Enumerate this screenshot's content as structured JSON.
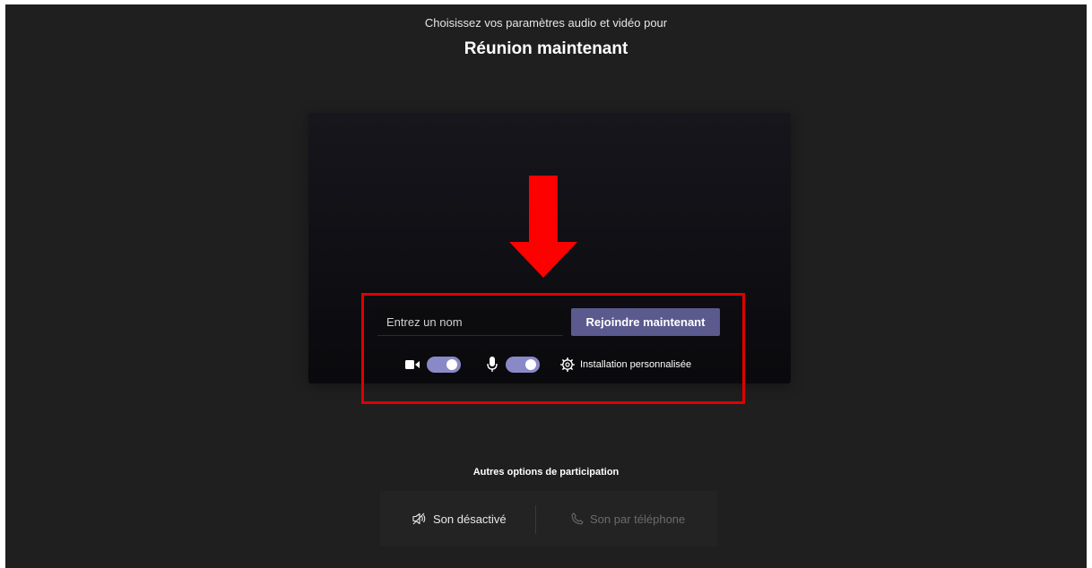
{
  "header": {
    "subtitle": "Choisissez vos paramètres audio et vidéo pour",
    "title": "Réunion maintenant"
  },
  "join_form": {
    "name_placeholder": "Entrez un nom",
    "join_label": "Rejoindre maintenant"
  },
  "devices": {
    "camera_icon": "video-camera-icon",
    "camera_on": true,
    "mic_icon": "microphone-icon",
    "mic_on": true,
    "custom_setup_icon": "gear-icon",
    "custom_setup_label": "Installation personnalisée"
  },
  "other_options": {
    "title": "Autres options de participation",
    "mute_label": "Son désactivé",
    "mute_icon": "speaker-off-icon",
    "phone_label": "Son par téléphone",
    "phone_icon": "phone-icon"
  },
  "annotations": {
    "arrow_color": "#ff0000",
    "box_color": "#e00000"
  },
  "colors": {
    "background": "#1f1f1f",
    "accent": "#5b5a8f",
    "toggle_on": "#8a89c7"
  }
}
